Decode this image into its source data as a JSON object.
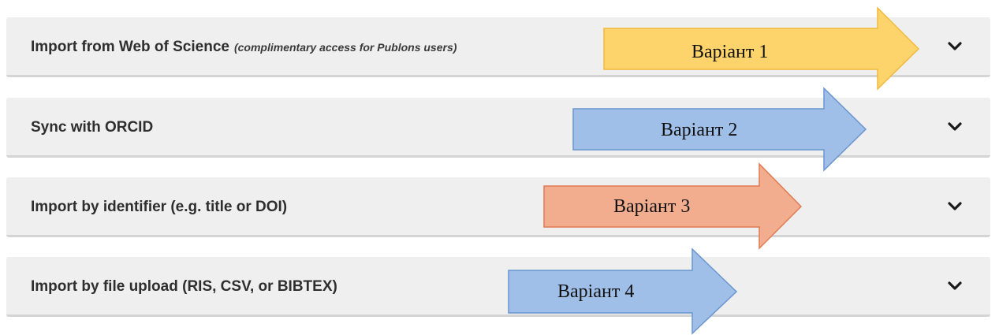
{
  "panels": [
    {
      "title": "Import from Web of Science",
      "note": "(complimentary access for Publons users)",
      "icon": "chevron-down-icon"
    },
    {
      "title": "Sync with ORCID",
      "icon": "chevron-down-icon"
    },
    {
      "title": "Import by identifier (e.g. title or DOI)",
      "icon": "chevron-down-icon"
    },
    {
      "title": "Import by file upload (RIS, CSV, or BIBTEX)",
      "icon": "chevron-down-icon"
    }
  ],
  "annotations": [
    {
      "label": "Варіант 1",
      "fill": "#fdd36b",
      "stroke": "#f2b93b"
    },
    {
      "label": "Варіант 2",
      "fill": "#9fbfe8",
      "stroke": "#6a96cf"
    },
    {
      "label": "Варіант 3",
      "fill": "#f2ad8e",
      "stroke": "#e07a52"
    },
    {
      "label": "Варіант 4",
      "fill": "#9fbfe8",
      "stroke": "#6a96cf"
    }
  ]
}
